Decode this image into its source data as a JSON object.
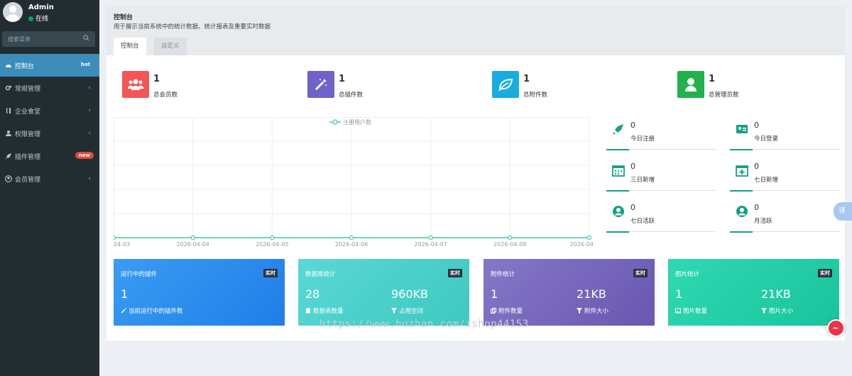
{
  "user": {
    "name": "Admin",
    "status": "在线"
  },
  "search": {
    "placeholder": "搜索菜单"
  },
  "menu": [
    {
      "label": "控制台",
      "icon": "dashboard-icon",
      "badge": "hot",
      "active": true
    },
    {
      "label": "常规管理",
      "icon": "cogs-icon",
      "arrow": "‹"
    },
    {
      "label": "企业食堂",
      "icon": "cutlery-icon",
      "arrow": "‹"
    },
    {
      "label": "权限管理",
      "icon": "group-icon",
      "arrow": "‹"
    },
    {
      "label": "插件管理",
      "icon": "rocket-icon",
      "badge": "new"
    },
    {
      "label": "会员管理",
      "icon": "user-circle-icon",
      "arrow": "‹"
    }
  ],
  "header": {
    "title": "控制台",
    "description": "用于展示当前系统中的统计数据、统计报表及重要实时数据"
  },
  "tabs": [
    "控制台",
    "自定义"
  ],
  "stats": [
    {
      "value": "1",
      "label": "总会员数",
      "color": "#f25656",
      "icon": "users-icon"
    },
    {
      "value": "1",
      "label": "总插件数",
      "color": "#6f62c9",
      "icon": "magic-icon"
    },
    {
      "value": "1",
      "label": "总附件数",
      "color": "#1aace0",
      "icon": "leaf-icon"
    },
    {
      "value": "1",
      "label": "总管理员数",
      "color": "#22b14c",
      "icon": "user-icon"
    }
  ],
  "chart_data": {
    "type": "line",
    "series": [
      {
        "name": "注册用户数",
        "values": [
          0,
          0,
          0,
          0,
          0,
          0,
          0
        ]
      }
    ],
    "x_tick_labels": [
      "04-03",
      "2026-04-04",
      "2026-04-05",
      "2026-04-06",
      "2026-04-07",
      "2026-04-08",
      "2026-04"
    ],
    "color": "#18bc9c",
    "legend": "top-center",
    "grid": true
  },
  "mini_stats": [
    {
      "value": "0",
      "label": "今日注册",
      "icon": "rocket-icon"
    },
    {
      "value": "0",
      "label": "今日登录",
      "icon": "vcard-icon"
    },
    {
      "value": "0",
      "label": "三日新增",
      "icon": "calendar-icon"
    },
    {
      "value": "0",
      "label": "七日新增",
      "icon": "calendar-plus-icon"
    },
    {
      "value": "0",
      "label": "七日活跃",
      "icon": "user-circle-icon"
    },
    {
      "value": "0",
      "label": "月活跃",
      "icon": "user-circle-icon"
    }
  ],
  "cards": [
    {
      "title": "运行中的插件",
      "tag": "实时",
      "value1": "1",
      "label1": "当前运行中的插件数",
      "value2": "",
      "label2": "",
      "bg": "#2e8ef0"
    },
    {
      "title": "数据库统计",
      "tag": "实时",
      "value1": "28",
      "label1": "数据表数量",
      "value2": "960KB",
      "label2": "占用空间",
      "bg": "#4fd2cf"
    },
    {
      "title": "附件统计",
      "tag": "实时",
      "value1": "1",
      "label1": "附件数量",
      "value2": "21KB",
      "label2": "附件大小",
      "bg": "#7b6bbf"
    },
    {
      "title": "图片统计",
      "tag": "实时",
      "value1": "1",
      "label1": "图片数量",
      "value2": "21KB",
      "label2": "图片大小",
      "bg": "#27d4a8"
    }
  ],
  "watermark": "https://www.huzhan.com/ishop44153",
  "translate_button": "译"
}
